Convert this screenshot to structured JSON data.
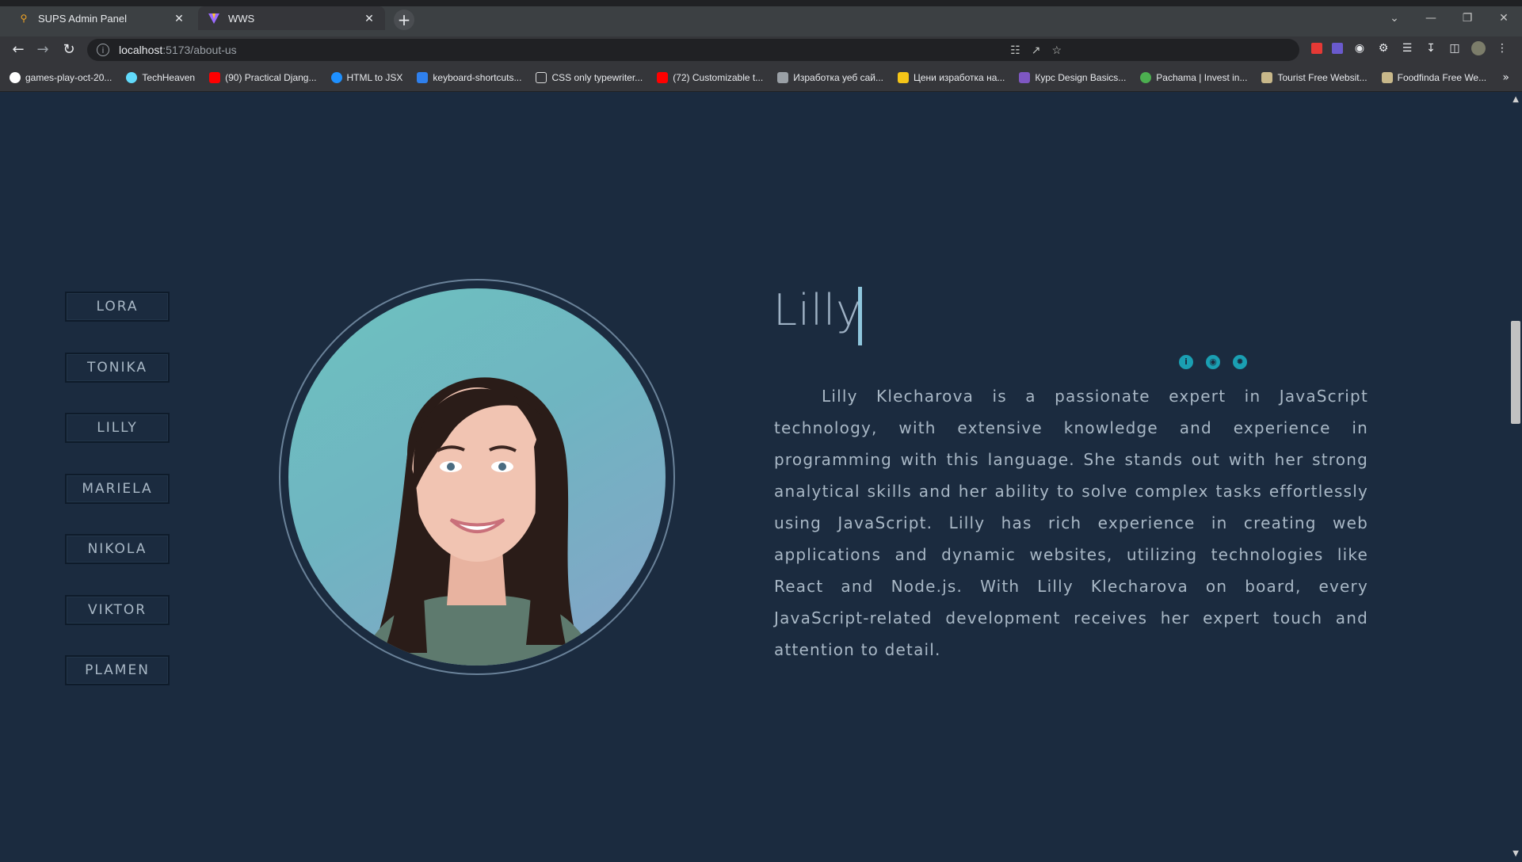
{
  "browser": {
    "tabs": [
      {
        "title": "SUPS Admin Panel",
        "active": false
      },
      {
        "title": "WWS",
        "active": true
      }
    ],
    "url_host": "localhost",
    "url_rest": ":5173/about-us",
    "bookmarks": [
      {
        "label": "games-play-oct-20...",
        "color": "#ffffff"
      },
      {
        "label": "TechHeaven",
        "color": "#61dafb"
      },
      {
        "label": "(90) Practical Djang...",
        "color": "#ff0000"
      },
      {
        "label": "HTML to JSX",
        "color": "#1e90ff"
      },
      {
        "label": "keyboard-shortcuts...",
        "color": "#2f80ed"
      },
      {
        "label": "CSS only typewriter...",
        "color": "#dddddd"
      },
      {
        "label": "(72) Customizable t...",
        "color": "#ff0000"
      },
      {
        "label": "Изработка уеб сай...",
        "color": "#9aa0a6"
      },
      {
        "label": "Цени изработка на...",
        "color": "#f5c518"
      },
      {
        "label": "Курс Design Basics...",
        "color": "#7e57c2"
      },
      {
        "label": "Pachama | Invest in...",
        "color": "#4caf50"
      },
      {
        "label": "Tourist Free Websit...",
        "color": "#c8b88a"
      },
      {
        "label": "Foodfinda Free We...",
        "color": "#c8b88a"
      }
    ]
  },
  "members": [
    "LORA",
    "TONIKA",
    "LILLY",
    "MARIELA",
    "NIKOLA",
    "VIKTOR",
    "PLAMEN"
  ],
  "profile": {
    "name": "Lilly",
    "bio": "Lilly Klecharova is a passionate expert in JavaScript technology, with extensive knowledge and experience in programming with this language. She stands out with her strong analytical skills and her ability to solve complex tasks effortlessly using JavaScript. Lilly has rich experience in creating web applications and dynamic websites, utilizing technologies like React and Node.js. With Lilly Klecharova on board, every JavaScript-related development receives her expert touch and attention to detail.",
    "social_icons": [
      "info-icon",
      "github-icon",
      "settings-badge-icon"
    ]
  },
  "colors": {
    "page_bg": "#1b2b3f",
    "accent": "#1a9fb2",
    "text": "#a9b8c6"
  }
}
